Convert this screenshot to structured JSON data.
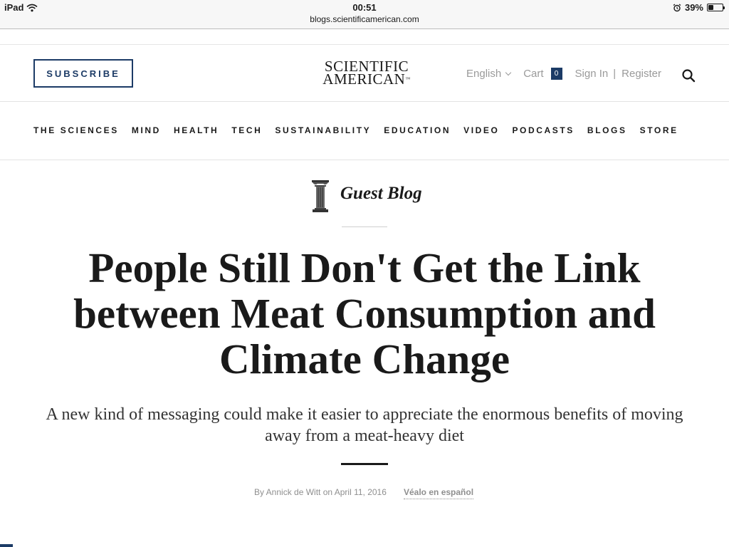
{
  "statusbar": {
    "device": "iPad",
    "time": "00:51",
    "url": "blogs.scientificamerican.com",
    "battery_text": "39%",
    "battery_level": 0.39
  },
  "header": {
    "subscribe_label": "SUBSCRIBE",
    "logo_line1": "SCIENTIFIC",
    "logo_line2": "AMERICAN",
    "logo_tm": "™",
    "language": "English",
    "cart_label": "Cart",
    "cart_count": "0",
    "sign_in": "Sign In",
    "separator": "|",
    "register": "Register"
  },
  "nav": {
    "items": [
      "THE SCIENCES",
      "MIND",
      "HEALTH",
      "TECH",
      "SUSTAINABILITY",
      "EDUCATION",
      "VIDEO",
      "PODCASTS",
      "BLOGS",
      "STORE"
    ]
  },
  "article": {
    "blog_name": "Guest Blog",
    "headline": "People Still Don't Get the Link between Meat Consumption and Climate Change",
    "dek": "A new kind of messaging could make it easier to appreciate the enormous benefits of moving away from a meat-heavy diet",
    "byline": "By Annick de Witt on April 11, 2016",
    "spanish_link": "Véalo en español"
  },
  "icons": {
    "wifi": "wifi-icon",
    "alarm": "alarm-icon",
    "search": "search-icon",
    "column": "column-icon"
  },
  "colors": {
    "brand_navy": "#1c3b66",
    "muted_text": "#9a9a9a"
  }
}
